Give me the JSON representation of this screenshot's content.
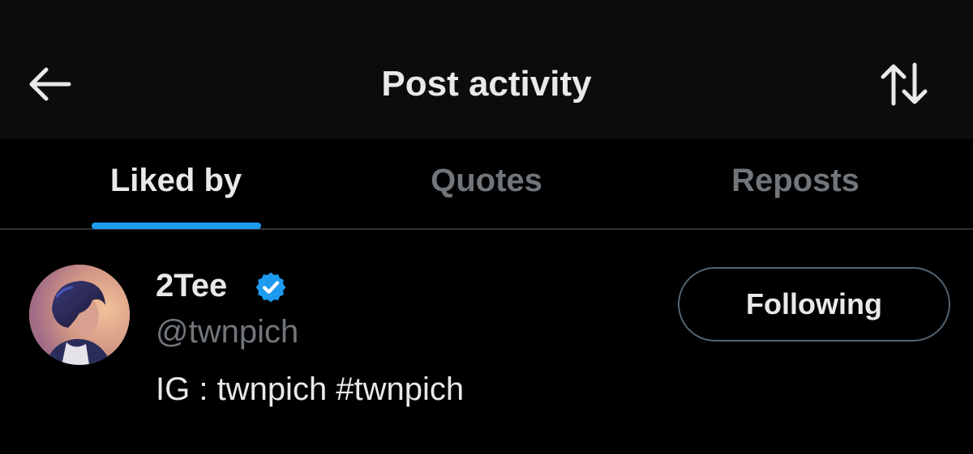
{
  "header": {
    "title": "Post activity",
    "back_icon": "arrow-left-icon",
    "sort_icon": "sort-arrows-icon"
  },
  "tabs": [
    {
      "label": "Liked by",
      "active": true
    },
    {
      "label": "Quotes",
      "active": false
    },
    {
      "label": "Reposts",
      "active": false
    }
  ],
  "user": {
    "display_name": "2Tee",
    "verified": true,
    "handle": "@twnpich",
    "bio": "IG : twnpich #twnpich",
    "follow_label": "Following"
  },
  "colors": {
    "background": "#000000",
    "header_background": "#0c0c0c",
    "text_primary": "#e7e9ea",
    "text_secondary": "#71767b",
    "accent": "#1d9bf0",
    "divider": "#2f3336"
  }
}
